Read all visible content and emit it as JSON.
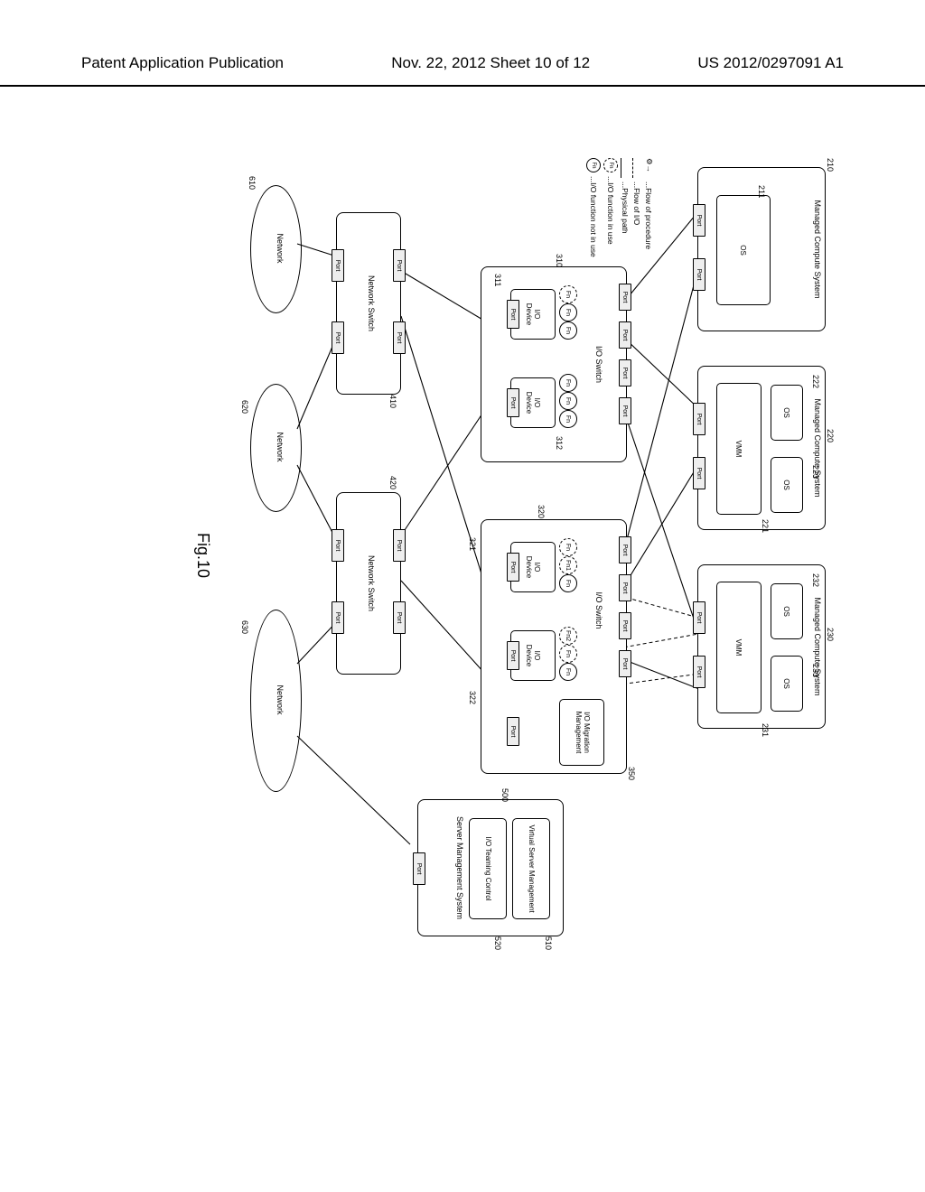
{
  "header": {
    "left": "Patent Application Publication",
    "center": "Nov. 22, 2012   Sheet 10 of 12",
    "right": "US 2012/0297091 A1"
  },
  "figure": {
    "caption": "Fig.10",
    "mcs_label": "Managed Compute System",
    "vmm": "VMM",
    "os": "OS",
    "port": "Port",
    "ioswitch": "I/O Switch",
    "iodevice": "I/O\nDevice",
    "iomigration": "I/O Migration\nManagement",
    "netswitch": "Network Switch",
    "network": "Network",
    "server_mgmt": "Server Management\nSystem",
    "vsm": "Virtual Server\nManagement",
    "iotc": "I/O Teaming\nControl",
    "fn": "Fn",
    "fn1": "Fn1",
    "fn2": "Fn2"
  },
  "refs": {
    "r210": "210",
    "r211": "211",
    "r220": "220",
    "r221": "221",
    "r222": "222",
    "r223": "223",
    "r230": "230",
    "r231": "231",
    "r232": "232",
    "r233": "233",
    "r310": "310",
    "r311": "311",
    "r312": "312",
    "r320": "320",
    "r321": "321",
    "r322": "322",
    "r350": "350",
    "r410": "410",
    "r420": "420",
    "r500": "500",
    "r510": "510",
    "r520": "520",
    "r610": "610",
    "r620": "620",
    "r630": "630"
  },
  "legend": {
    "flow_proc": "...Flow of procedure",
    "flow_io": "...Flow of I/O",
    "phys_path": "...Physical path",
    "fn_in_use": "...I/O function in use",
    "fn_not_use": "...I/O function not in use"
  },
  "chart_data": {
    "type": "diagram",
    "nodes": [
      {
        "id": "mcs210",
        "label": "Managed Compute System",
        "children": [
          "os211"
        ],
        "ports": 2
      },
      {
        "id": "os211",
        "label": "OS"
      },
      {
        "id": "mcs220",
        "label": "Managed Compute System",
        "children": [
          "vmm221",
          "os222",
          "os223"
        ],
        "ports": 2
      },
      {
        "id": "vmm221",
        "label": "VMM"
      },
      {
        "id": "os222",
        "label": "OS"
      },
      {
        "id": "os223",
        "label": "OS"
      },
      {
        "id": "mcs230",
        "label": "Managed Compute System",
        "children": [
          "vmm231",
          "os232",
          "os233"
        ],
        "ports": 2
      },
      {
        "id": "vmm231",
        "label": "VMM"
      },
      {
        "id": "os232",
        "label": "OS"
      },
      {
        "id": "os233",
        "label": "OS"
      },
      {
        "id": "iosw310",
        "label": "I/O Switch",
        "upstream_ports": 4,
        "devices": [
          "dev311",
          "dev312"
        ]
      },
      {
        "id": "dev311",
        "label": "I/O Device",
        "functions": 3
      },
      {
        "id": "dev312",
        "label": "I/O Device",
        "functions": 3
      },
      {
        "id": "iosw320",
        "label": "I/O Switch",
        "upstream_ports": 4,
        "devices": [
          "dev321",
          "dev322"
        ],
        "extra": [
          "iomig350"
        ]
      },
      {
        "id": "dev321",
        "label": "I/O Device",
        "functions": 3,
        "fn_in_use": [
          "Fn1"
        ]
      },
      {
        "id": "dev322",
        "label": "I/O Device",
        "functions": 3,
        "fn_in_use": [
          "Fn2",
          "Fn"
        ]
      },
      {
        "id": "iomig350",
        "label": "I/O Migration Management"
      },
      {
        "id": "netsw410",
        "label": "Network Switch",
        "up_ports": 2,
        "down_ports": 2
      },
      {
        "id": "netsw420",
        "label": "Network Switch",
        "up_ports": 2,
        "down_ports": 2
      },
      {
        "id": "net610",
        "label": "Network"
      },
      {
        "id": "net620",
        "label": "Network"
      },
      {
        "id": "net630",
        "label": "Network"
      },
      {
        "id": "srv500",
        "label": "Server Management System",
        "children": [
          "vsm510",
          "iotc520"
        ],
        "ports": 1
      },
      {
        "id": "vsm510",
        "label": "Virtual Server Management"
      },
      {
        "id": "iotc520",
        "label": "I/O Teaming Control"
      }
    ],
    "edges_physical": [
      [
        "mcs210.port0",
        "iosw310.port0"
      ],
      [
        "mcs210.port1",
        "iosw320.port0"
      ],
      [
        "mcs220.port0",
        "iosw310.port1"
      ],
      [
        "mcs220.port1",
        "iosw320.port1"
      ],
      [
        "mcs230.port0",
        "iosw310.port3"
      ],
      [
        "mcs230.port1",
        "iosw320.port3"
      ],
      [
        "dev311.port",
        "netsw410.up0"
      ],
      [
        "dev312.port",
        "netsw420.up0"
      ],
      [
        "dev321.port",
        "netsw410.up1"
      ],
      [
        "dev322.port",
        "netsw420.up1"
      ],
      [
        "netsw410.down",
        "net610"
      ],
      [
        "netsw410.down",
        "net620"
      ],
      [
        "netsw420.down",
        "net620"
      ],
      [
        "netsw420.down",
        "net630"
      ],
      [
        "srv500.port",
        "net630"
      ]
    ],
    "edges_flow_io_dashed": [
      [
        "os232",
        "dev321.Fn1"
      ],
      [
        "os232",
        "dev322.Fn2"
      ],
      [
        "os233",
        "dev322.Fn"
      ]
    ],
    "legend_symbols": [
      {
        "symbol": "gear-arrow",
        "label": "Flow of procedure"
      },
      {
        "symbol": "dashed-arrow",
        "label": "Flow of I/O"
      },
      {
        "symbol": "solid-line",
        "label": "Physical path"
      },
      {
        "symbol": "dashed-circle-Fn",
        "label": "I/O function in use"
      },
      {
        "symbol": "solid-circle-Fn",
        "label": "I/O function not in use"
      }
    ]
  }
}
